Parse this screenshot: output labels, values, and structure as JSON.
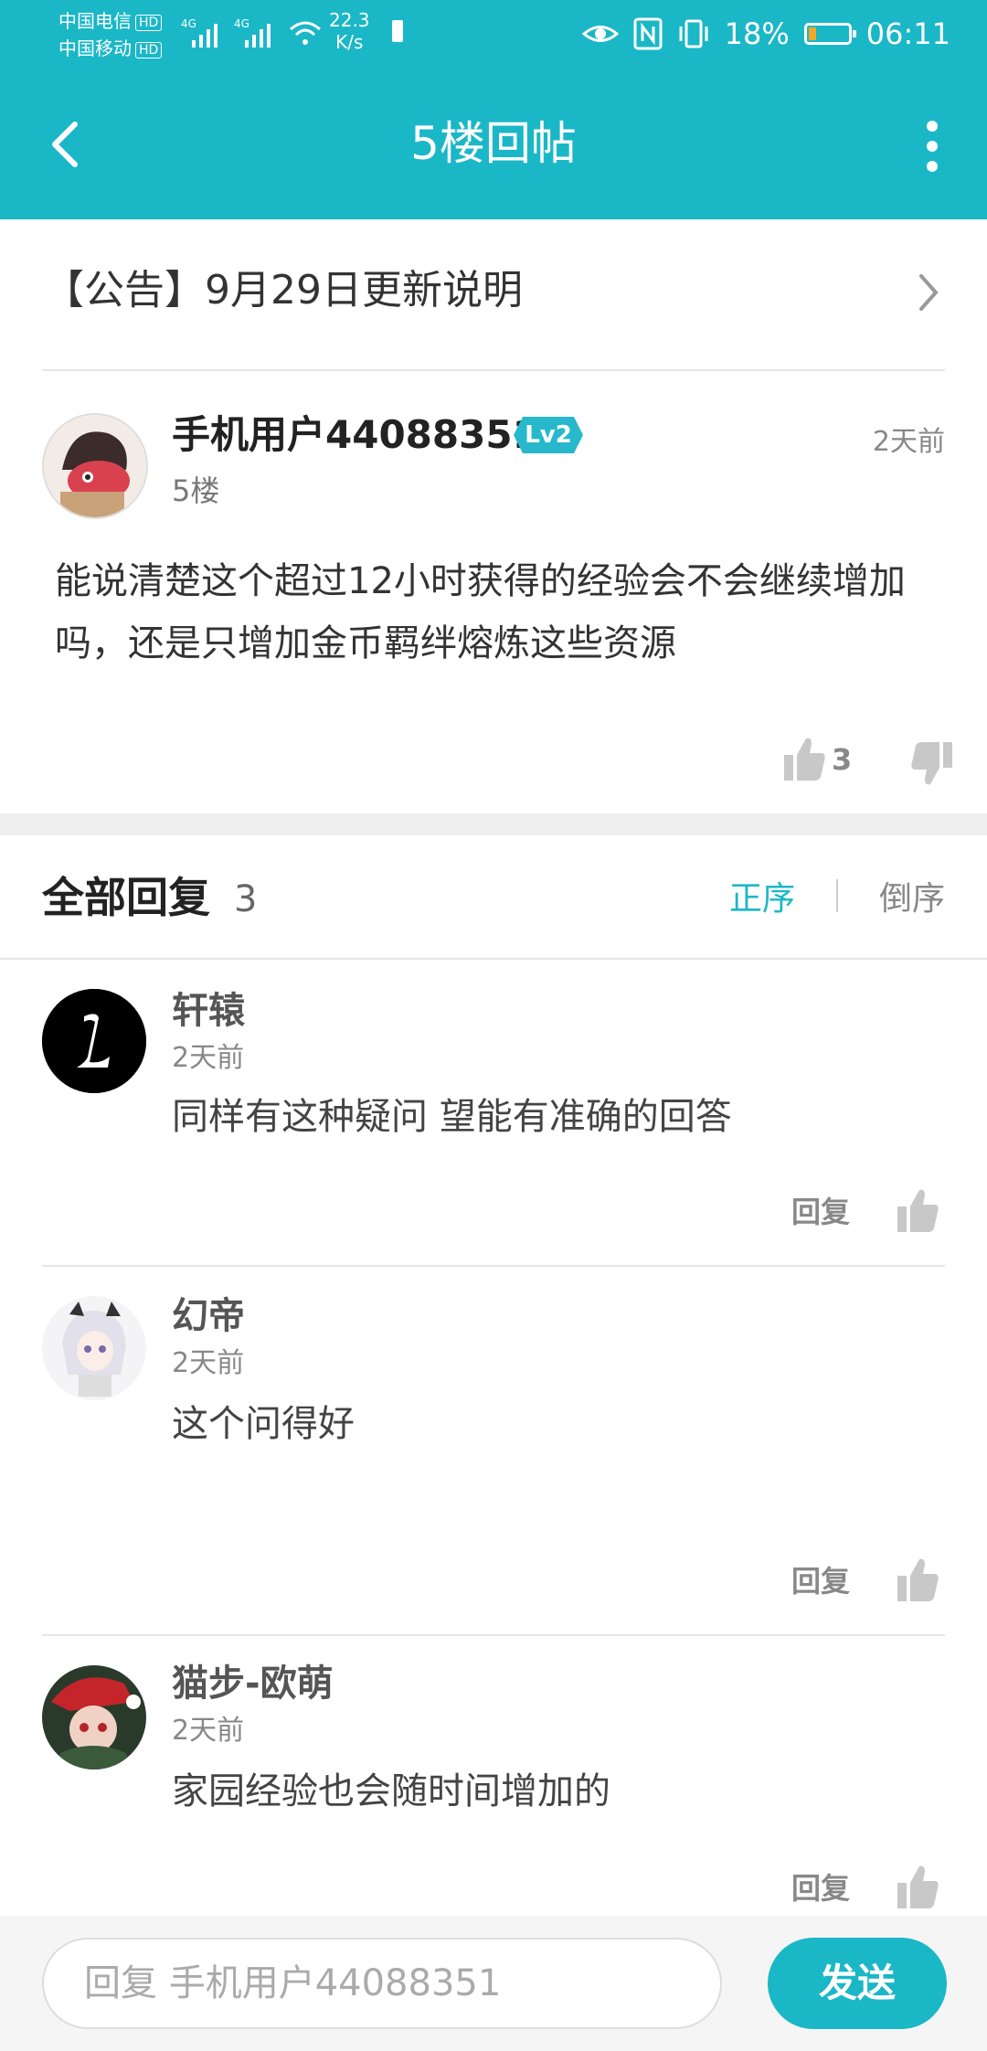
{
  "status_bar": {
    "carrier1": "中国电信",
    "carrier2": "中国移动",
    "hd": "HD",
    "speed_value": "22.3",
    "speed_unit": "K/s",
    "battery": "18%",
    "time": "06:11",
    "battery_level": 0.18,
    "battery_color": "#f5a623"
  },
  "header": {
    "title": "5楼回帖",
    "bg_color": "#1ab7c7"
  },
  "notice": {
    "text": "【公告】9月29日更新说明"
  },
  "post": {
    "author": "手机用户44088351",
    "level": "Lv2",
    "time": "2天前",
    "floor": "5楼",
    "content": "能说清楚这个超过12小时获得的经验会不会继续增加吗，还是只增加金币羁绊熔炼这些资源",
    "likes": "3"
  },
  "replies_section": {
    "title": "全部回复",
    "count": "3",
    "sort_asc": "正序",
    "sort_desc": "倒序"
  },
  "replies": [
    {
      "name": "轩辕",
      "time": "2天前",
      "text": "同样有这种疑问 望能有准确的回答",
      "reply_label": "回复"
    },
    {
      "name": "幻帝",
      "time": "2天前",
      "text": "这个问得好",
      "reply_label": "回复"
    },
    {
      "name": "猫步-欧萌",
      "time": "2天前",
      "text": "家园经验也会随时间增加的",
      "reply_label": "回复"
    }
  ],
  "composer": {
    "placeholder": "回复 手机用户44088351",
    "send_label": "发送"
  },
  "colors": {
    "accent": "#1ab7c7",
    "divider": "#e5e5e5"
  }
}
